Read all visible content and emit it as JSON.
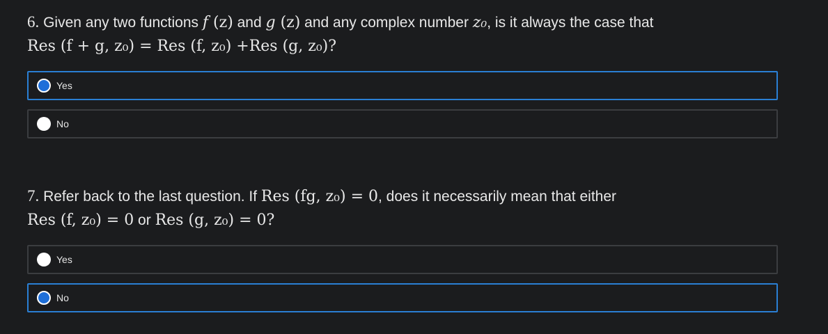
{
  "questions": [
    {
      "number": "6.",
      "text_a": " Given any two functions ",
      "f": "f",
      "fz": " (z)",
      "and1": " and ",
      "g": "g",
      "gz": " (z)",
      "text_b": " and any complex number ",
      "z0": "z₀",
      "text_c": ", is it always the case that",
      "line2": "Res (f + g, z₀) = Res (f, z₀) +Res (g, z₀)?",
      "options": [
        {
          "label": "Yes",
          "selected": true
        },
        {
          "label": "No",
          "selected": false
        }
      ]
    },
    {
      "number": "7.",
      "text_a": " Refer back to the last question. If ",
      "math1": "Res (fg, z₀) = 0",
      "text_b": ", does it necessarily mean that either",
      "line2_a": "Res (f, z₀) = 0",
      "line2_or": " or ",
      "line2_b": "Res (g, z₀) = 0?",
      "options": [
        {
          "label": "Yes",
          "selected": false
        },
        {
          "label": "No",
          "selected": true
        }
      ]
    }
  ],
  "colors": {
    "background": "#1b1c1e",
    "selected_border": "#2a7fd4",
    "border": "#3b3d40",
    "radio_selected": "#1e6fd9"
  }
}
